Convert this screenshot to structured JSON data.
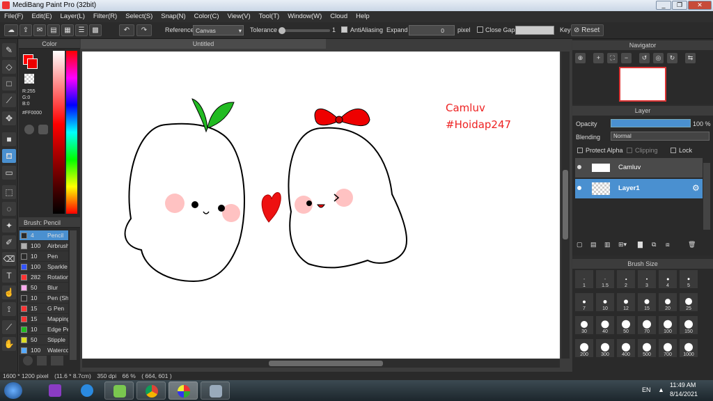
{
  "app": {
    "title": "MediBang Paint Pro (32bit)"
  },
  "window_buttons": {
    "minimize": "_",
    "restore": "❐",
    "close": "✕"
  },
  "menu": [
    "File(F)",
    "Edit(E)",
    "Layer(L)",
    "Filter(R)",
    "Select(S)",
    "Snap(N)",
    "Color(C)",
    "View(V)",
    "Tool(T)",
    "Window(W)",
    "Cloud",
    "Help"
  ],
  "toolbar": {
    "reference_label": "Reference",
    "reference_value": "Canvas",
    "tolerance_label": "Tolerance",
    "tolerance_value": "1",
    "antialiasing_label": "AntiAliasing",
    "expand_label": "Expand",
    "expand_value": "0",
    "expand_unit": "pixel",
    "close_gaps_label": "Close Gaps",
    "key_label": "Key",
    "reset_label": "Reset"
  },
  "color_panel": {
    "title": "Color",
    "r": "R:255",
    "g": "G:0",
    "b": "B:0",
    "hex": "#FF0000",
    "primary": "#ff0000"
  },
  "brush_panel": {
    "title": "Brush: Pencil",
    "items": [
      {
        "size": "4",
        "name": "Pencil",
        "color": "#2a2a2a",
        "selected": true
      },
      {
        "size": "100",
        "name": "Airbrush",
        "color": "#b0b0b0"
      },
      {
        "size": "10",
        "name": "Pen",
        "color": "#2a2a2a"
      },
      {
        "size": "100",
        "name": "Sparkle",
        "color": "#3355ff"
      },
      {
        "size": "282",
        "name": "Rotation",
        "color": "#ff3333"
      },
      {
        "size": "50",
        "name": "Blur",
        "color": "#ffaaee"
      },
      {
        "size": "10",
        "name": "Pen (Sharp)",
        "color": "#2a2a2a"
      },
      {
        "size": "15",
        "name": "G Pen",
        "color": "#ff3333"
      },
      {
        "size": "15",
        "name": "Mapping",
        "color": "#ff3333"
      },
      {
        "size": "10",
        "name": "Edge Pen",
        "color": "#22bb22"
      },
      {
        "size": "50",
        "name": "Stipple",
        "color": "#dddd22"
      },
      {
        "size": "100",
        "name": "Watercolor",
        "color": "#55aaff"
      }
    ]
  },
  "document": {
    "tab": "Untitled",
    "text_line1": "Camluv",
    "text_line2": "#Hoidap247"
  },
  "navigator": {
    "title": "Navigator"
  },
  "layer_panel": {
    "title": "Layer",
    "opacity_label": "Opacity",
    "opacity_value": "100 %",
    "opacity_fraction": 1.0,
    "blending_label": "Blending",
    "blending_value": "Normal",
    "protect_alpha": "Protect Alpha",
    "clipping": "Clipping",
    "lock": "Lock",
    "layers": [
      {
        "name": "Camluv",
        "selected": false
      },
      {
        "name": "Layer1",
        "selected": true
      }
    ]
  },
  "brush_size_panel": {
    "title": "Brush Size",
    "sizes": [
      "1",
      "1.5",
      "2",
      "3",
      "4",
      "5",
      "7",
      "10",
      "12",
      "15",
      "20",
      "25",
      "30",
      "40",
      "50",
      "70",
      "100",
      "150",
      "200",
      "300",
      "400",
      "500",
      "700",
      "1000"
    ]
  },
  "status": {
    "dimensions": "1600 * 1200 pixel",
    "physical": "(11.6 * 8.7cm)",
    "dpi": "350 dpi",
    "zoom": "66 %",
    "coords": "( 664, 601 )"
  },
  "taskbar": {
    "lang": "EN",
    "time": "11:49 AM",
    "date": "8/14/2021"
  },
  "colors": {
    "accent": "#4a90d0",
    "red": "#ff0000",
    "green": "#22bb22"
  }
}
